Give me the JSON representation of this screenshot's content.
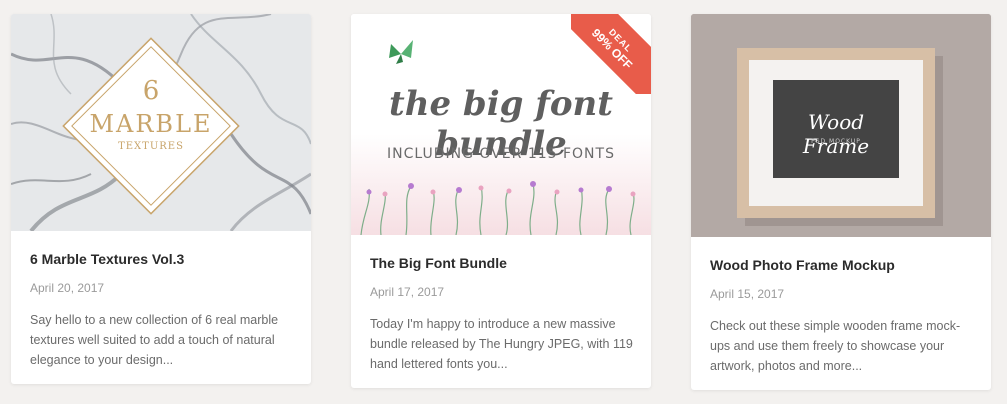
{
  "cards": [
    {
      "thumb": {
        "number": "6",
        "word": "MARBLE",
        "sub": "TEXTURES"
      },
      "title": "6 Marble Textures Vol.3",
      "date": "April 20, 2017",
      "excerpt": "Say hello to a new collection of 6 real marble textures well suited to add a touch of natural elegance to your design..."
    },
    {
      "thumb": {
        "headline": "the big font bundle",
        "sub": "INCLUDING OVER 115 FONTS",
        "badge_top": "DEAL",
        "badge_bottom": "99% OFF"
      },
      "title": "The Big Font Bundle",
      "date": "April 17, 2017",
      "excerpt": "Today I'm happy to introduce a new massive bundle released by The Hungry JPEG, with 119 hand lettered fonts you..."
    },
    {
      "thumb": {
        "frame_title": "Wood Frame",
        "frame_sub": "PSD MOCKUP"
      },
      "title": "Wood Photo Frame Mockup",
      "date": "April 15, 2017",
      "excerpt": "Check out these simple wooden frame mock-ups and use them freely to showcase your artwork, photos and more..."
    }
  ],
  "colors": {
    "page_bg": "#f3f1ef",
    "card_bg": "#ffffff",
    "title": "#2b2b2b",
    "date": "#9a9a9a",
    "excerpt": "#6b6b6b",
    "deal_badge": "#e85c4a",
    "marble_gold": "#c8a46a",
    "frame_bg": "#b3a9a5"
  }
}
